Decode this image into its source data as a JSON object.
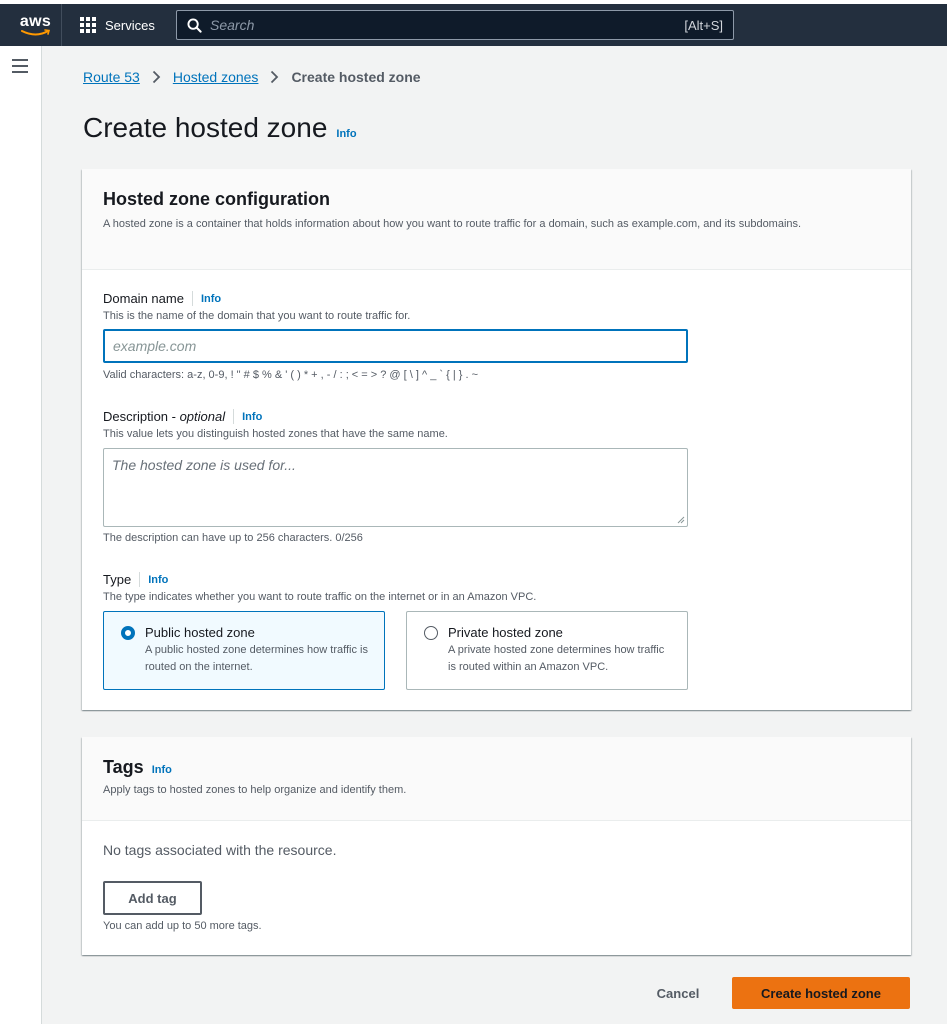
{
  "topnav": {
    "logo_text": "aws",
    "services_label": "Services",
    "search_placeholder": "Search",
    "search_shortcut": "[Alt+S]"
  },
  "breadcrumb": {
    "items": [
      "Route 53",
      "Hosted zones"
    ],
    "current": "Create hosted zone"
  },
  "page": {
    "title": "Create hosted zone",
    "info": "Info"
  },
  "config": {
    "title": "Hosted zone configuration",
    "description": "A hosted zone is a container that holds information about how you want to route traffic for a domain, such as example.com, and its subdomains.",
    "domain": {
      "label": "Domain name",
      "info": "Info",
      "description": "This is the name of the domain that you want to route traffic for.",
      "placeholder": "example.com",
      "value": "",
      "hint": "Valid characters: a-z, 0-9, ! \" # $ % & ' ( ) * + , - / : ; < = > ? @ [ \\ ] ^ _ ` { | } . ~"
    },
    "description_field": {
      "label_main": "Description - ",
      "label_optional": "optional",
      "info": "Info",
      "description": "This value lets you distinguish hosted zones that have the same name.",
      "placeholder": "The hosted zone is used for...",
      "hint": "The description can have up to 256 characters. 0/256"
    },
    "type": {
      "label": "Type",
      "info": "Info",
      "description": "The type indicates whether you want to route traffic on the internet or in an Amazon VPC.",
      "options": [
        {
          "title": "Public hosted zone",
          "desc": "A public hosted zone determines how traffic is routed on the internet.",
          "selected": true
        },
        {
          "title": "Private hosted zone",
          "desc": "A private hosted zone determines how traffic is routed within an Amazon VPC.",
          "selected": false
        }
      ]
    }
  },
  "tags": {
    "title": "Tags",
    "info": "Info",
    "description": "Apply tags to hosted zones to help organize and identify them.",
    "empty": "No tags associated with the resource.",
    "add_button": "Add tag",
    "hint": "You can add up to 50 more tags."
  },
  "actions": {
    "cancel": "Cancel",
    "create": "Create hosted zone"
  },
  "colors": {
    "topbar": "#232f3e",
    "link": "#0073bb",
    "primary": "#ec7211",
    "selected_tile_bg": "#f1faff"
  }
}
